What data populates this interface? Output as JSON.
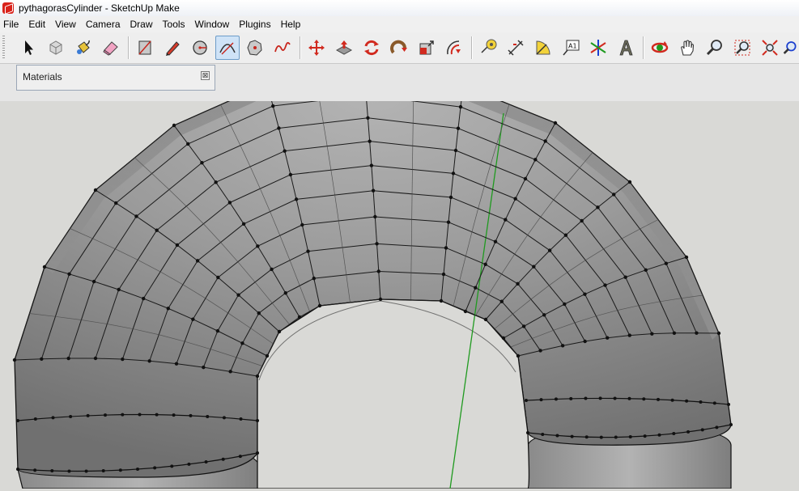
{
  "window": {
    "title": "pythagorasCylinder - SketchUp Make"
  },
  "menu": {
    "items": [
      {
        "label": "File"
      },
      {
        "label": "Edit"
      },
      {
        "label": "View"
      },
      {
        "label": "Camera"
      },
      {
        "label": "Draw"
      },
      {
        "label": "Tools"
      },
      {
        "label": "Window"
      },
      {
        "label": "Plugins"
      },
      {
        "label": "Help"
      }
    ]
  },
  "toolbar": {
    "tools": [
      {
        "icon": "select-arrow-icon"
      },
      {
        "icon": "make-component-icon"
      },
      {
        "icon": "paint-bucket-icon"
      },
      {
        "icon": "eraser-icon"
      },
      {
        "icon": "rectangle-icon"
      },
      {
        "icon": "line-pencil-icon"
      },
      {
        "icon": "circle-icon"
      },
      {
        "icon": "arc-icon",
        "active": true
      },
      {
        "icon": "polygon-icon"
      },
      {
        "icon": "freehand-icon"
      },
      {
        "icon": "move-icon"
      },
      {
        "icon": "push-pull-icon"
      },
      {
        "icon": "rotate-icon"
      },
      {
        "icon": "follow-me-icon"
      },
      {
        "icon": "scale-icon"
      },
      {
        "icon": "offset-icon"
      },
      {
        "icon": "tape-measure-icon"
      },
      {
        "icon": "dimension-icon"
      },
      {
        "icon": "protractor-icon"
      },
      {
        "icon": "text-label-icon",
        "text": "A1"
      },
      {
        "icon": "axes-icon"
      },
      {
        "icon": "3d-text-icon"
      },
      {
        "icon": "orbit-icon"
      },
      {
        "icon": "pan-hand-icon"
      },
      {
        "icon": "zoom-icon"
      },
      {
        "icon": "zoom-window-icon"
      },
      {
        "icon": "zoom-extents-icon"
      },
      {
        "icon": "previous-view-icon"
      }
    ]
  },
  "materials_panel": {
    "title": "Materials",
    "close_symbol": "⊠"
  },
  "colors": {
    "background": "#d9d9d6",
    "model_face": "#9a9a9a",
    "edge": "#111111",
    "green_axis": "#1f9a1f"
  }
}
